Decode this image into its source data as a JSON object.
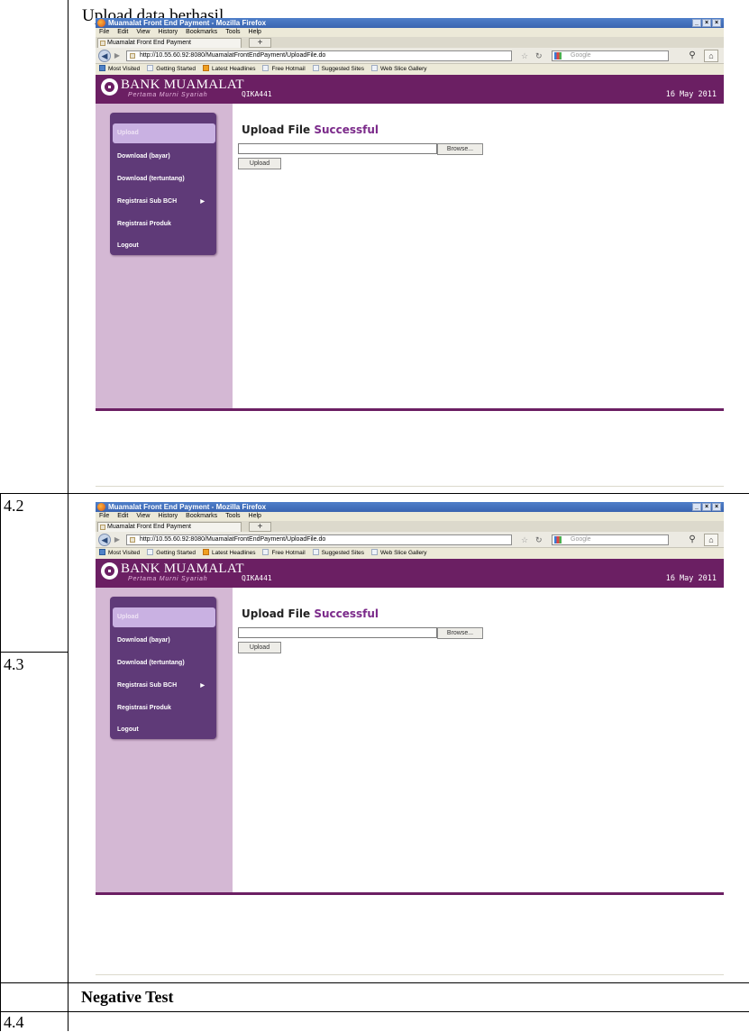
{
  "caption": "Upload data berhasil",
  "row_labels": [
    "4.2",
    "4.3",
    "4.4"
  ],
  "negative_test": "Negative Test",
  "screenshot": {
    "window_title": "Muamalat Front End Payment - Mozilla Firefox",
    "window_buttons": [
      "_",
      "×",
      "×"
    ],
    "menu": [
      "File",
      "Edit",
      "View",
      "History",
      "Bookmarks",
      "Tools",
      "Help"
    ],
    "tab_title": "Muamalat Front End Payment",
    "new_tab": "+",
    "url": "http://10.55.60.92:8080/MuamalatFrontEndPayment/UploadFile.do",
    "search_placeholder": "Google",
    "bookmarks": [
      "Most Visited",
      "Getting Started",
      "Latest Headlines",
      "Free Hotmail",
      "Suggested Sites",
      "Web Slice Gallery"
    ],
    "bank_name": "BANK MUAMALAT",
    "bank_tagline": "Pertama Murni Syariah",
    "user_id": "QIKA441",
    "date": "16 May 2011",
    "menu_items": [
      "Upload",
      "Download (bayar)",
      "Download (tertuntang)",
      "Registrasi Sub BCH",
      "Registrasi Produk",
      "Logout"
    ],
    "heading_prefix": "Upload File",
    "heading_status": "Successful",
    "browse_label": "Browse...",
    "upload_label": "Upload"
  },
  "colors": {
    "brand": "#6b1f63",
    "menu_bg": "#5f3a78",
    "sidebar_bg": "#d4b8d4",
    "success": "#7b2a8a"
  }
}
